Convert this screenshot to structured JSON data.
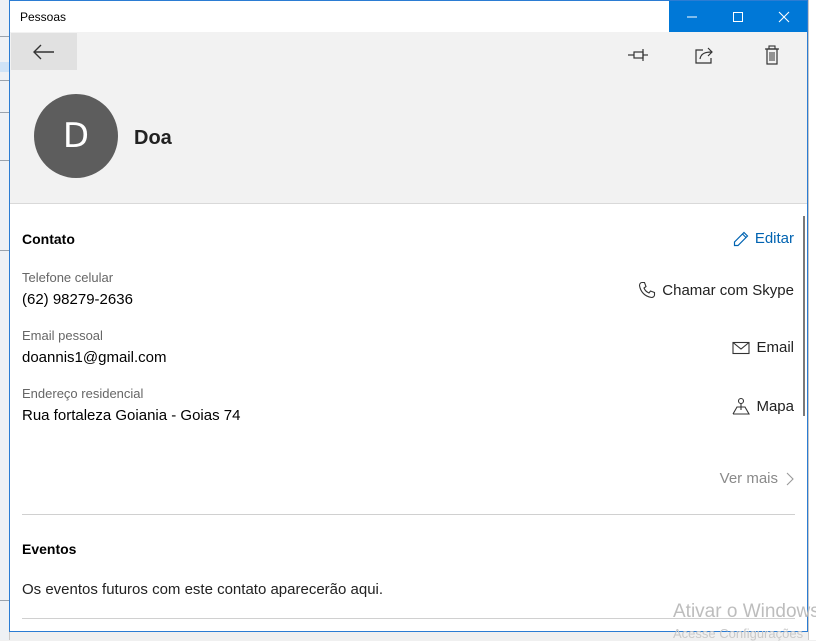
{
  "window": {
    "title": "Pessoas",
    "controls": [
      "minimize-icon",
      "maximize-icon",
      "close-icon"
    ],
    "accent_color": "#0078d7"
  },
  "toolbar": {
    "back_icon": "back-arrow-icon",
    "actions": [
      "pin-icon",
      "share-icon",
      "delete-icon"
    ]
  },
  "contact": {
    "initial": "D",
    "name": "Doa",
    "avatar_color": "#5d5d5d"
  },
  "contact_section": {
    "title": "Contato",
    "edit_label": "Editar",
    "fields": [
      {
        "label": "Telefone celular",
        "value": "(62) 98279-2636",
        "action": "Chamar com Skype",
        "action_icon": "phone-icon"
      },
      {
        "label": "Email pessoal",
        "value": "doannis1@gmail.com",
        "action": "Email",
        "action_icon": "mail-icon"
      },
      {
        "label": "Endereço residencial",
        "value": "Rua fortaleza Goiania - Goias 74",
        "action": "Mapa",
        "action_icon": "map-pin-icon"
      }
    ],
    "see_more": "Ver mais"
  },
  "events_section": {
    "title": "Eventos",
    "text": "Os eventos futuros com este contato aparecerão aqui."
  },
  "watermark": {
    "line1": "Ativar o Windows",
    "line2": "Acesse Configurações"
  }
}
